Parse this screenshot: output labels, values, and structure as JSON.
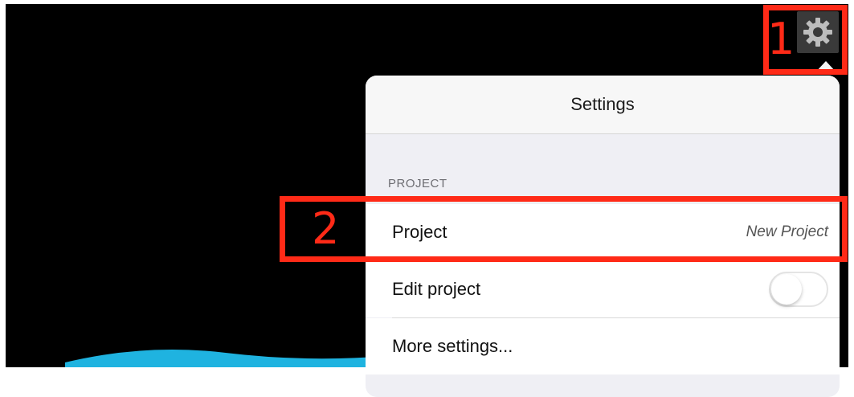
{
  "popover": {
    "title": "Settings",
    "section_header": "PROJECT",
    "rows": [
      {
        "label": "Project",
        "value": "New Project"
      },
      {
        "label": "Edit project",
        "toggle_on": false
      },
      {
        "label": "More settings..."
      }
    ]
  },
  "annotations": {
    "step1": "1",
    "step2": "2"
  },
  "colors": {
    "annotation": "#ff2a17",
    "wave": "#1fb3e0",
    "background": "#000000"
  },
  "icons": {
    "settings_button": "gear-icon"
  }
}
